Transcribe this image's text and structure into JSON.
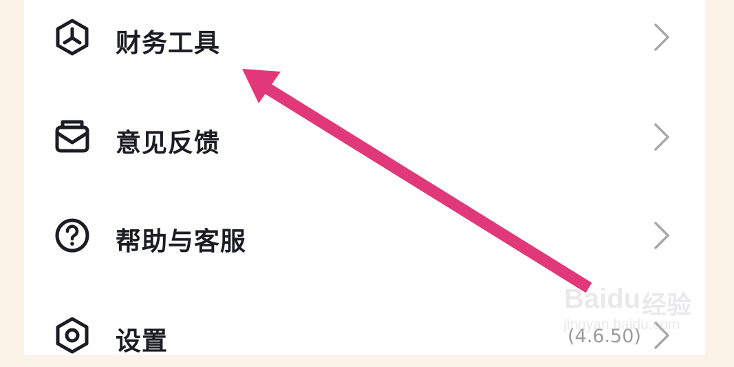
{
  "menu": {
    "items": [
      {
        "label": "财务工具",
        "icon": "finance-tool-icon"
      },
      {
        "label": "意见反馈",
        "icon": "feedback-envelope-icon"
      },
      {
        "label": "帮助与客服",
        "icon": "help-question-icon"
      },
      {
        "label": "设置",
        "icon": "settings-hexagon-icon",
        "extra": "(4.6.50)"
      }
    ]
  },
  "annotation": {
    "arrow_color": "#e03878"
  },
  "watermark": {
    "brand": "Baidu",
    "cn": "经验",
    "url": "jingyan.baidu.com"
  }
}
